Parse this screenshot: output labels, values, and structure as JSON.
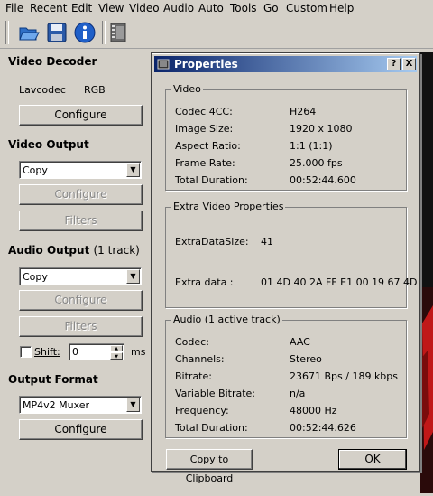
{
  "menu": [
    "File",
    "Recent",
    "Edit",
    "View",
    "Video",
    "Audio",
    "Auto",
    "Tools",
    "Go",
    "Custom",
    "Help"
  ],
  "toolbar": {
    "icons": [
      "open-folder-icon",
      "save-icon",
      "info-icon",
      "film-icon"
    ]
  },
  "video_decoder": {
    "title": "Video Decoder",
    "codec": "Lavcodec",
    "colorspace": "RGB",
    "configure": "Configure"
  },
  "video_output": {
    "title": "Video Output",
    "selected": "Copy",
    "configure": "Configure",
    "filters": "Filters"
  },
  "audio_output": {
    "title": "Audio Output",
    "tracks": "(1 track)",
    "selected": "Copy",
    "configure": "Configure",
    "filters": "Filters",
    "shift_label": "Shift:",
    "shift_value": "0",
    "shift_unit": "ms"
  },
  "output_format": {
    "title": "Output Format",
    "selected": "MP4v2 Muxer",
    "configure": "Configure"
  },
  "dialog": {
    "title": "Properties",
    "help_btn": "?",
    "close_btn": "X",
    "video": {
      "title": "Video",
      "rows": [
        {
          "label": "Codec 4CC:",
          "value": "H264"
        },
        {
          "label": "Image Size:",
          "value": "1920 x 1080"
        },
        {
          "label": "Aspect Ratio:",
          "value": "1:1 (1:1)"
        },
        {
          "label": "Frame Rate:",
          "value": "25.000 fps"
        },
        {
          "label": "Total Duration:",
          "value": "00:52:44.600"
        }
      ]
    },
    "extra": {
      "title": "Extra Video Properties",
      "extradata_size_label": "ExtraDataSize:",
      "extradata_size_value": "41",
      "extradata_label": "Extra data :",
      "extradata_value": "01 4D 40 2A FF E1 00 19 67 4D"
    },
    "audio": {
      "title": "Audio (1 active track)",
      "rows": [
        {
          "label": "Codec:",
          "value": "AAC"
        },
        {
          "label": "Channels:",
          "value": "Stereo"
        },
        {
          "label": "Bitrate:",
          "value": "23671 Bps / 189 kbps"
        },
        {
          "label": "Variable Bitrate:",
          "value": "n/a"
        },
        {
          "label": "Frequency:",
          "value": "48000 Hz"
        },
        {
          "label": "Total Duration:",
          "value": "00:52:44.626"
        }
      ]
    },
    "copy_btn": "Copy to Clipboard",
    "ok_btn": "OK"
  }
}
